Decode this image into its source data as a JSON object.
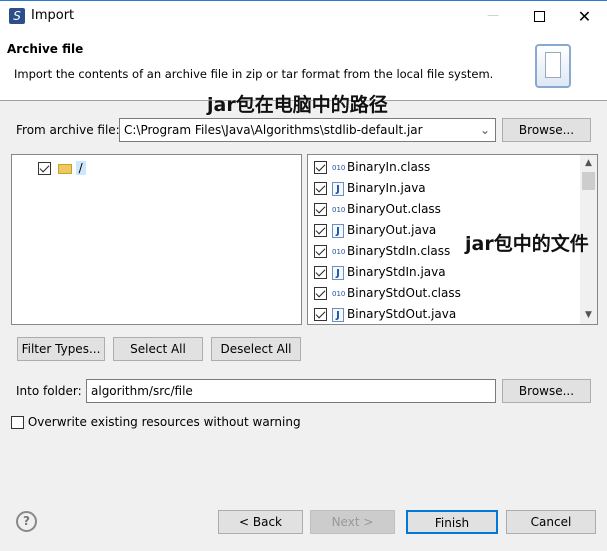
{
  "window": {
    "title": "Import",
    "app_icon": "eclipse-s-icon",
    "controls": [
      "minimize",
      "maximize",
      "close"
    ]
  },
  "header": {
    "title": "Archive file",
    "description": "Import the contents of an archive file in zip or tar format from the local file system.",
    "banner_icon": "import-wizard-icon"
  },
  "annotations": {
    "path": "jar包在电脑中的路径",
    "files": "jar包中的文件"
  },
  "from": {
    "label": "From archive file:",
    "value": "C:\\Program Files\\Java\\Algorithms\\stdlib-default.jar",
    "browse": "Browse..."
  },
  "tree": {
    "root": "/",
    "checked": true
  },
  "files": [
    {
      "name": "BinaryIn.class",
      "type": "class",
      "checked": true
    },
    {
      "name": "BinaryIn.java",
      "type": "java",
      "checked": true
    },
    {
      "name": "BinaryOut.class",
      "type": "class",
      "checked": true
    },
    {
      "name": "BinaryOut.java",
      "type": "java",
      "checked": true
    },
    {
      "name": "BinaryStdIn.class",
      "type": "class",
      "checked": true
    },
    {
      "name": "BinaryStdIn.java",
      "type": "java",
      "checked": true
    },
    {
      "name": "BinaryStdOut.class",
      "type": "class",
      "checked": true
    },
    {
      "name": "BinaryStdOut.java",
      "type": "java",
      "checked": true
    }
  ],
  "selection_buttons": {
    "filter": "Filter Types...",
    "select_all": "Select All",
    "deselect_all": "Deselect All"
  },
  "into": {
    "label": "Into folder:",
    "value": "algorithm/src/file",
    "browse": "Browse..."
  },
  "overwrite": {
    "label": "Overwrite existing resources without warning",
    "checked": false
  },
  "footer": {
    "back": "< Back",
    "next": "Next >",
    "finish": "Finish",
    "cancel": "Cancel",
    "next_enabled": false
  }
}
